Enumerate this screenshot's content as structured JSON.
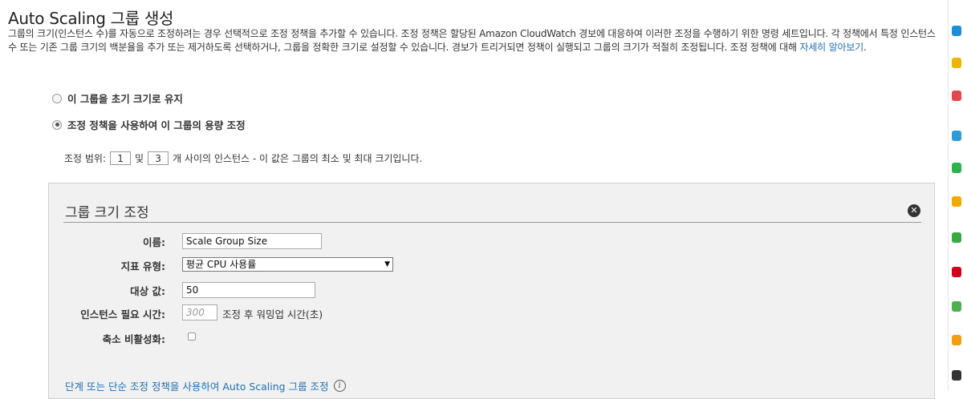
{
  "header": {
    "title": "Auto Scaling 그룹 생성",
    "description": "그룹의 크기(인스턴스 수)를 자동으로 조정하려는 경우 선택적으로 조정 정책을 추가할 수 있습니다. 조정 정책은 할당된 Amazon CloudWatch 경보에 대응하여 이러한 조정을 수행하기 위한 명령 세트입니다. 각 정책에서 특정 인스턴스 수 또는 기존 그룹 크기의 백분율을 추가 또는 제거하도록 선택하거나, 그룹을 정확한 크기로 설정할 수 있습니다. 경보가 트리거되면 정책이 실행되고 그룹의 크기가 적절히 조정됩니다. 조정 정책에 대해",
    "learn_more_link": "자세히 알아보기",
    "learn_more_suffix": "."
  },
  "options": {
    "keep_initial_size": "이 그룹을 초기 크기로 유지",
    "use_scaling_policies": "조정 정책을 사용하여 이 그룹의 용량 조정",
    "selected": "use_scaling_policies"
  },
  "range": {
    "prefix": "조정 범위:",
    "min": "1",
    "conjunction": "및",
    "max": "3",
    "suffix": "개 사이의 인스턴스 - 이 값은 그룹의 최소 및 최대 크기입니다."
  },
  "panel": {
    "title": "그룹 크기 조정",
    "name_label": "이름:",
    "name_value": "Scale Group Size",
    "metric_label": "지표 유형:",
    "metric_value": "평균 CPU 사용률",
    "target_label": "대상 값:",
    "target_value": "50",
    "warmup_label": "인스턴스 필요 시간:",
    "warmup_placeholder": "300",
    "warmup_suffix": "조정 후 워밍업 시간(초)",
    "disable_scale_in_label": "축소 비활성화:",
    "disable_scale_in_checked": false,
    "step_policy_link": "단계 또는 단순 조정 정책을 사용하여 Auto Scaling 그룹 조정"
  },
  "side_icons": [
    {
      "name": "blue-service-icon",
      "color": "#1a8fd8"
    },
    {
      "name": "yellow-service-icon",
      "color": "#f0b400"
    },
    {
      "name": "red-service-icon",
      "color": "#e0484d"
    },
    {
      "name": "teal-service-icon",
      "color": "#2e9bd6"
    },
    {
      "name": "green-service-icon",
      "color": "#2bb24c"
    },
    {
      "name": "orange-service-icon",
      "color": "#f2a900"
    },
    {
      "name": "green-bar-icon",
      "color": "#3aa843"
    },
    {
      "name": "red-box-icon",
      "color": "#d0021b"
    },
    {
      "name": "green-chart-icon",
      "color": "#4caf50"
    },
    {
      "name": "orange-box-icon",
      "color": "#f39c12"
    },
    {
      "name": "dark-icon",
      "color": "#333333"
    }
  ]
}
